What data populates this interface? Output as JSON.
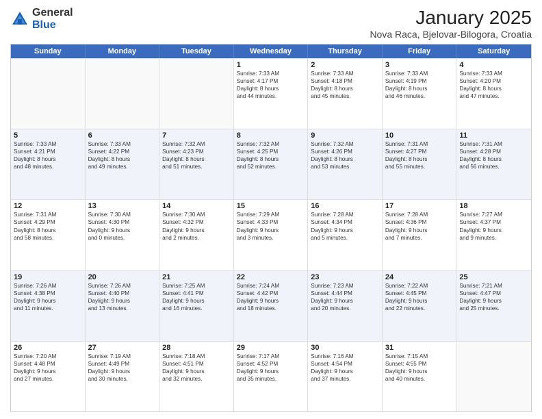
{
  "logo": {
    "general": "General",
    "blue": "Blue"
  },
  "title": "January 2025",
  "subtitle": "Nova Raca, Bjelovar-Bilogora, Croatia",
  "headers": [
    "Sunday",
    "Monday",
    "Tuesday",
    "Wednesday",
    "Thursday",
    "Friday",
    "Saturday"
  ],
  "rows": [
    [
      {
        "day": "",
        "lines": [],
        "empty": true
      },
      {
        "day": "",
        "lines": [],
        "empty": true
      },
      {
        "day": "",
        "lines": [],
        "empty": true
      },
      {
        "day": "1",
        "lines": [
          "Sunrise: 7:33 AM",
          "Sunset: 4:17 PM",
          "Daylight: 8 hours",
          "and 44 minutes."
        ]
      },
      {
        "day": "2",
        "lines": [
          "Sunrise: 7:33 AM",
          "Sunset: 4:18 PM",
          "Daylight: 8 hours",
          "and 45 minutes."
        ]
      },
      {
        "day": "3",
        "lines": [
          "Sunrise: 7:33 AM",
          "Sunset: 4:19 PM",
          "Daylight: 8 hours",
          "and 46 minutes."
        ]
      },
      {
        "day": "4",
        "lines": [
          "Sunrise: 7:33 AM",
          "Sunset: 4:20 PM",
          "Daylight: 8 hours",
          "and 47 minutes."
        ]
      }
    ],
    [
      {
        "day": "5",
        "lines": [
          "Sunrise: 7:33 AM",
          "Sunset: 4:21 PM",
          "Daylight: 8 hours",
          "and 48 minutes."
        ]
      },
      {
        "day": "6",
        "lines": [
          "Sunrise: 7:33 AM",
          "Sunset: 4:22 PM",
          "Daylight: 8 hours",
          "and 49 minutes."
        ]
      },
      {
        "day": "7",
        "lines": [
          "Sunrise: 7:32 AM",
          "Sunset: 4:23 PM",
          "Daylight: 8 hours",
          "and 51 minutes."
        ]
      },
      {
        "day": "8",
        "lines": [
          "Sunrise: 7:32 AM",
          "Sunset: 4:25 PM",
          "Daylight: 8 hours",
          "and 52 minutes."
        ]
      },
      {
        "day": "9",
        "lines": [
          "Sunrise: 7:32 AM",
          "Sunset: 4:26 PM",
          "Daylight: 8 hours",
          "and 53 minutes."
        ]
      },
      {
        "day": "10",
        "lines": [
          "Sunrise: 7:31 AM",
          "Sunset: 4:27 PM",
          "Daylight: 8 hours",
          "and 55 minutes."
        ]
      },
      {
        "day": "11",
        "lines": [
          "Sunrise: 7:31 AM",
          "Sunset: 4:28 PM",
          "Daylight: 8 hours",
          "and 56 minutes."
        ]
      }
    ],
    [
      {
        "day": "12",
        "lines": [
          "Sunrise: 7:31 AM",
          "Sunset: 4:29 PM",
          "Daylight: 8 hours",
          "and 58 minutes."
        ]
      },
      {
        "day": "13",
        "lines": [
          "Sunrise: 7:30 AM",
          "Sunset: 4:30 PM",
          "Daylight: 9 hours",
          "and 0 minutes."
        ]
      },
      {
        "day": "14",
        "lines": [
          "Sunrise: 7:30 AM",
          "Sunset: 4:32 PM",
          "Daylight: 9 hours",
          "and 2 minutes."
        ]
      },
      {
        "day": "15",
        "lines": [
          "Sunrise: 7:29 AM",
          "Sunset: 4:33 PM",
          "Daylight: 9 hours",
          "and 3 minutes."
        ]
      },
      {
        "day": "16",
        "lines": [
          "Sunrise: 7:28 AM",
          "Sunset: 4:34 PM",
          "Daylight: 9 hours",
          "and 5 minutes."
        ]
      },
      {
        "day": "17",
        "lines": [
          "Sunrise: 7:28 AM",
          "Sunset: 4:36 PM",
          "Daylight: 9 hours",
          "and 7 minutes."
        ]
      },
      {
        "day": "18",
        "lines": [
          "Sunrise: 7:27 AM",
          "Sunset: 4:37 PM",
          "Daylight: 9 hours",
          "and 9 minutes."
        ]
      }
    ],
    [
      {
        "day": "19",
        "lines": [
          "Sunrise: 7:26 AM",
          "Sunset: 4:38 PM",
          "Daylight: 9 hours",
          "and 11 minutes."
        ]
      },
      {
        "day": "20",
        "lines": [
          "Sunrise: 7:26 AM",
          "Sunset: 4:40 PM",
          "Daylight: 9 hours",
          "and 13 minutes."
        ]
      },
      {
        "day": "21",
        "lines": [
          "Sunrise: 7:25 AM",
          "Sunset: 4:41 PM",
          "Daylight: 9 hours",
          "and 16 minutes."
        ]
      },
      {
        "day": "22",
        "lines": [
          "Sunrise: 7:24 AM",
          "Sunset: 4:42 PM",
          "Daylight: 9 hours",
          "and 18 minutes."
        ]
      },
      {
        "day": "23",
        "lines": [
          "Sunrise: 7:23 AM",
          "Sunset: 4:44 PM",
          "Daylight: 9 hours",
          "and 20 minutes."
        ]
      },
      {
        "day": "24",
        "lines": [
          "Sunrise: 7:22 AM",
          "Sunset: 4:45 PM",
          "Daylight: 9 hours",
          "and 22 minutes."
        ]
      },
      {
        "day": "25",
        "lines": [
          "Sunrise: 7:21 AM",
          "Sunset: 4:47 PM",
          "Daylight: 9 hours",
          "and 25 minutes."
        ]
      }
    ],
    [
      {
        "day": "26",
        "lines": [
          "Sunrise: 7:20 AM",
          "Sunset: 4:48 PM",
          "Daylight: 9 hours",
          "and 27 minutes."
        ]
      },
      {
        "day": "27",
        "lines": [
          "Sunrise: 7:19 AM",
          "Sunset: 4:49 PM",
          "Daylight: 9 hours",
          "and 30 minutes."
        ]
      },
      {
        "day": "28",
        "lines": [
          "Sunrise: 7:18 AM",
          "Sunset: 4:51 PM",
          "Daylight: 9 hours",
          "and 32 minutes."
        ]
      },
      {
        "day": "29",
        "lines": [
          "Sunrise: 7:17 AM",
          "Sunset: 4:52 PM",
          "Daylight: 9 hours",
          "and 35 minutes."
        ]
      },
      {
        "day": "30",
        "lines": [
          "Sunrise: 7:16 AM",
          "Sunset: 4:54 PM",
          "Daylight: 9 hours",
          "and 37 minutes."
        ]
      },
      {
        "day": "31",
        "lines": [
          "Sunrise: 7:15 AM",
          "Sunset: 4:55 PM",
          "Daylight: 9 hours",
          "and 40 minutes."
        ]
      },
      {
        "day": "",
        "lines": [],
        "empty": true
      }
    ]
  ]
}
